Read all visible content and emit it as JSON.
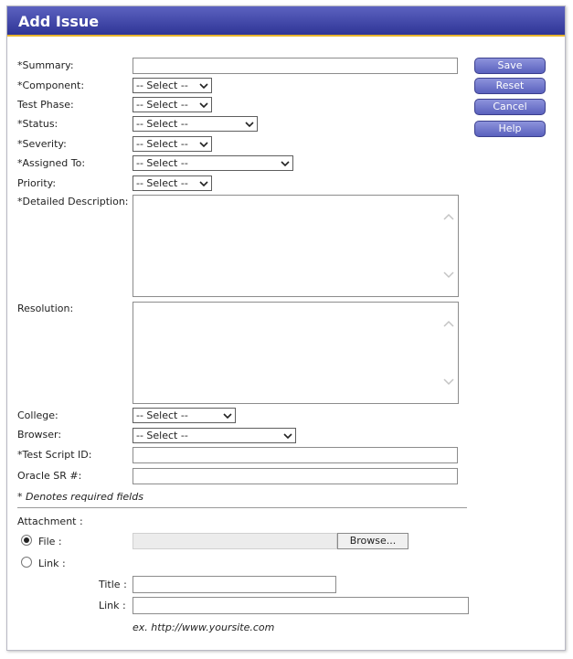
{
  "window": {
    "title": "Add Issue"
  },
  "fields": {
    "summary": {
      "label": "*Summary:",
      "value": ""
    },
    "component": {
      "label": "*Component:",
      "value": "-- Select --"
    },
    "test_phase": {
      "label": "Test Phase:",
      "value": "-- Select --"
    },
    "status": {
      "label": "*Status:",
      "value": "-- Select --"
    },
    "severity": {
      "label": "*Severity:",
      "value": "-- Select --"
    },
    "assigned_to": {
      "label": "*Assigned To:",
      "value": "-- Select --"
    },
    "priority": {
      "label": "Priority:",
      "value": "-- Select --"
    },
    "detailed_description": {
      "label": "*Detailed Description:",
      "value": ""
    },
    "resolution": {
      "label": "Resolution:",
      "value": ""
    },
    "college": {
      "label": "College:",
      "value": "-- Select --"
    },
    "browser": {
      "label": "Browser:",
      "value": "-- Select --"
    },
    "test_script_id": {
      "label": "*Test Script ID:",
      "value": ""
    },
    "oracle_sr": {
      "label": "Oracle SR #:",
      "value": ""
    }
  },
  "required_note": "* Denotes required fields",
  "buttons": {
    "save": "Save",
    "reset": "Reset",
    "cancel": "Cancel",
    "help": "Help"
  },
  "attachment": {
    "heading": "Attachment :",
    "file_option": "File :",
    "link_option": "Link :",
    "file_selected": true,
    "browse_label": "Browse...",
    "title_label": "Title :",
    "link_label": "Link :",
    "example": "ex. http://www.yoursite.com"
  },
  "icons": [
    "chevron-down-icon",
    "scroll-up-icon",
    "scroll-down-icon",
    "radio-selected-icon",
    "radio-empty-icon"
  ]
}
